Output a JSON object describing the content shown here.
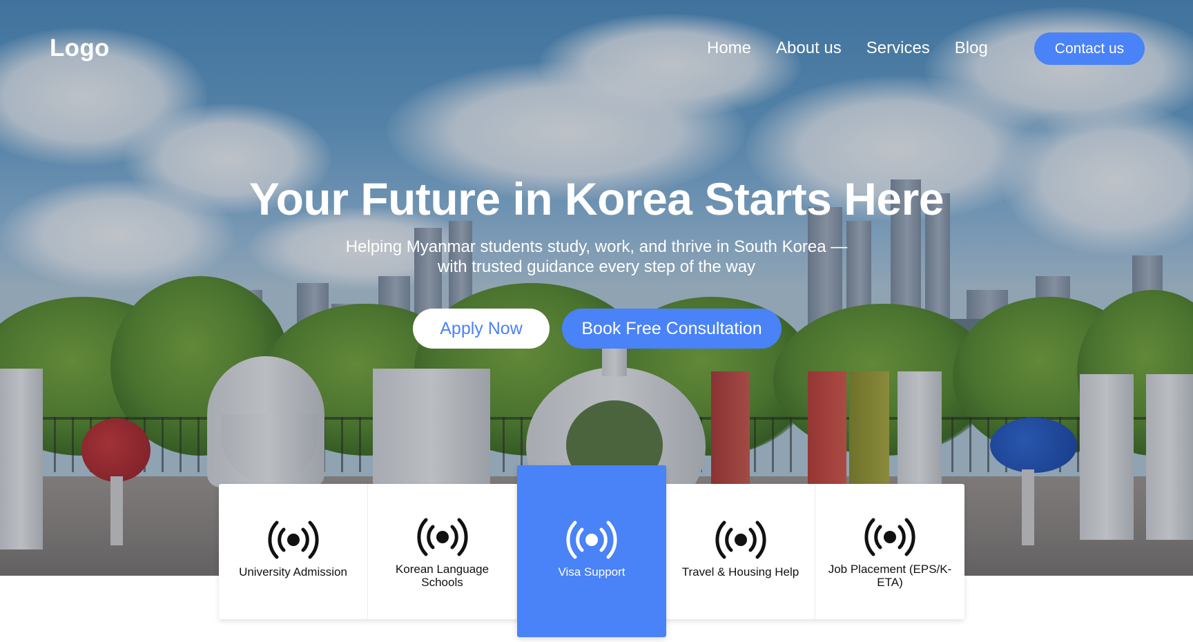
{
  "nav": {
    "logo": "Logo",
    "links": [
      "Home",
      "About us",
      "Services",
      "Blog"
    ],
    "contact_label": "Contact us"
  },
  "hero": {
    "title": "Your Future in Korea Starts Here",
    "subtitle_line1": "Helping Myanmar students study, work, and thrive in South Korea —",
    "subtitle_line2": "with trusted guidance every step of the way",
    "apply_label": "Apply Now",
    "book_label": "Book Free Consultation"
  },
  "services": [
    {
      "label": "University Admission",
      "icon": "broadcast-icon",
      "active": false
    },
    {
      "label": "Korean Language Schools",
      "icon": "broadcast-icon",
      "active": false
    },
    {
      "label": "Visa Support",
      "icon": "broadcast-icon",
      "active": true
    },
    {
      "label": "Travel & Housing Help",
      "icon": "broadcast-icon",
      "active": false
    },
    {
      "label": "Job Placement (EPS/K-ETA)",
      "icon": "broadcast-icon",
      "active": false
    }
  ],
  "colors": {
    "accent": "#4a82f7",
    "text_dark": "#111111",
    "white": "#ffffff"
  }
}
